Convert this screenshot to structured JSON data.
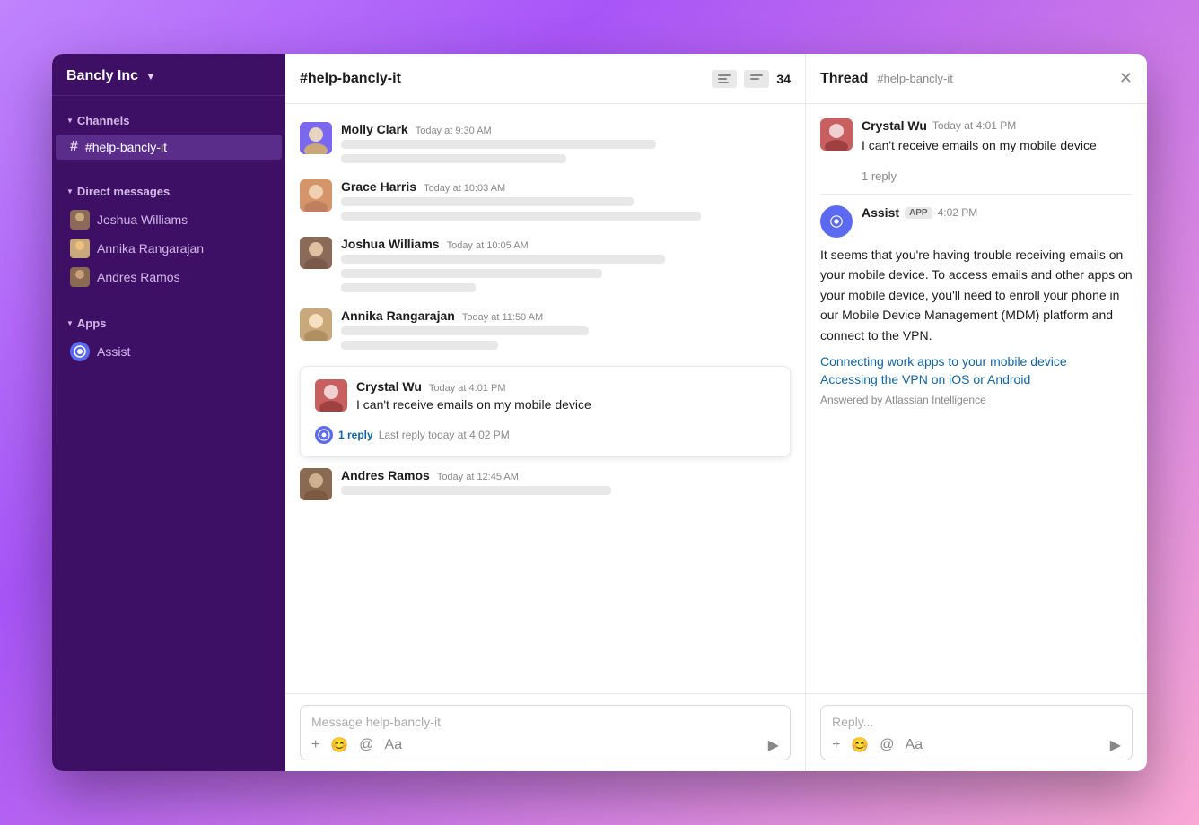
{
  "workspace": {
    "name": "Bancly Inc",
    "chevron": "▼"
  },
  "sidebar": {
    "channels_label": "Channels",
    "active_channel": "#help-bancly-it",
    "channels": [
      {
        "name": "help-bancly-it",
        "id": "help-bancly-it"
      }
    ],
    "dm_label": "Direct messages",
    "dms": [
      {
        "name": "Joshua Williams"
      },
      {
        "name": "Annika Rangarajan"
      },
      {
        "name": "Andres Ramos"
      }
    ],
    "apps_label": "Apps",
    "apps": [
      {
        "name": "Assist"
      }
    ]
  },
  "chat": {
    "channel": "#help-bancly-it",
    "member_count": "34",
    "messages": [
      {
        "sender": "Molly Clark",
        "time": "Today at 9:30 AM",
        "lines": [
          2,
          1
        ]
      },
      {
        "sender": "Grace Harris",
        "time": "Today at 10:03 AM",
        "lines": [
          2,
          1
        ]
      },
      {
        "sender": "Joshua Williams",
        "time": "Today at 10:05 AM",
        "lines": [
          2,
          1
        ]
      },
      {
        "sender": "Annika Rangarajan",
        "time": "Today at 11:50 AM",
        "lines": [
          1
        ]
      }
    ],
    "highlighted_message": {
      "sender": "Crystal Wu",
      "time": "Today at 4:01 PM",
      "text": "I can't receive emails on my mobile device",
      "reply_count": "1 reply",
      "last_reply": "Last reply today at 4:02 PM"
    },
    "last_message": {
      "sender": "Andres Ramos",
      "time": "Today at 12:45 AM",
      "lines": [
        1
      ]
    },
    "input_placeholder": "Message help-bancly-it",
    "input_actions": [
      "+",
      "😊",
      "@",
      "Aa"
    ],
    "send_icon": "▶"
  },
  "thread": {
    "label": "Thread",
    "channel": "#help-bancly-it",
    "close": "✕",
    "original_message": {
      "sender": "Crystal Wu",
      "time": "Today at 4:01 PM",
      "text": "I can't receive emails on my mobile device"
    },
    "reply_count": "1 reply",
    "assist_message": {
      "sender": "Assist",
      "badge": "APP",
      "time": "4:02 PM",
      "text": "It seems that you're having trouble receiving emails on your mobile device. To access emails and other apps on your mobile device, you'll need to enroll your phone in our Mobile Device Management (MDM) platform and connect to the VPN.",
      "links": [
        "Connecting work apps to your mobile device",
        "Accessing the VPN on iOS or Android"
      ],
      "answered_by": "Answered by Atlassian Intelligence"
    },
    "reply_placeholder": "Reply...",
    "reply_actions": [
      "+",
      "😊",
      "@",
      "Aa"
    ],
    "send_icon": "▶"
  }
}
